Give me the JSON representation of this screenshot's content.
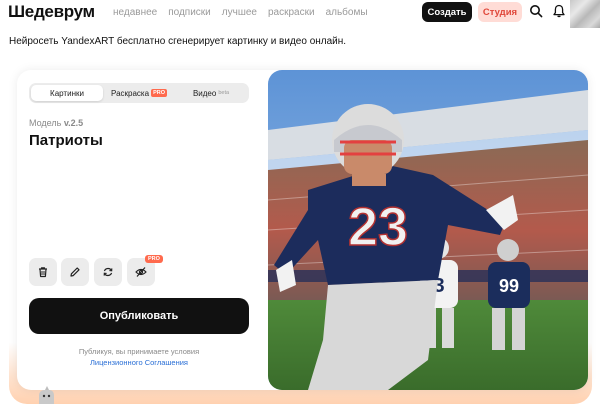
{
  "header": {
    "logo": "Шедеврум",
    "nav": [
      "недавнее",
      "подписки",
      "лучшее",
      "раскраски",
      "альбомы"
    ],
    "create_label": "Создать",
    "studio_label": "Студия",
    "icons": [
      "search-icon",
      "bell-icon",
      "avatar"
    ]
  },
  "tagline": "Нейросеть YandexART бесплатно сгенерирует картинку и видео онлайн.",
  "editor": {
    "tabs": [
      {
        "label": "Картинки",
        "active": true
      },
      {
        "label": "Раскраска",
        "badge": "PRO"
      },
      {
        "label": "Видео",
        "badge": "beta"
      }
    ],
    "model_prefix": "Модель",
    "model_version": "v.2.5",
    "prompt": "Патриоты",
    "tools": [
      "trash-icon",
      "pencil-icon",
      "refresh-icon",
      "eye-off-icon"
    ],
    "tool_pro_badge": "PRO",
    "publish_label": "Опубликовать",
    "terms_text": "Публикуя, вы принимаете условия",
    "terms_link": "Лицензионного Соглашения"
  },
  "image": {
    "jersey_number": "23"
  },
  "colors": {
    "primary": "#111111",
    "studio_bg": "#ffdcd6",
    "studio_text": "#e0473a",
    "pro_badge": "#ff6a4d",
    "link": "#2a6fd6"
  }
}
